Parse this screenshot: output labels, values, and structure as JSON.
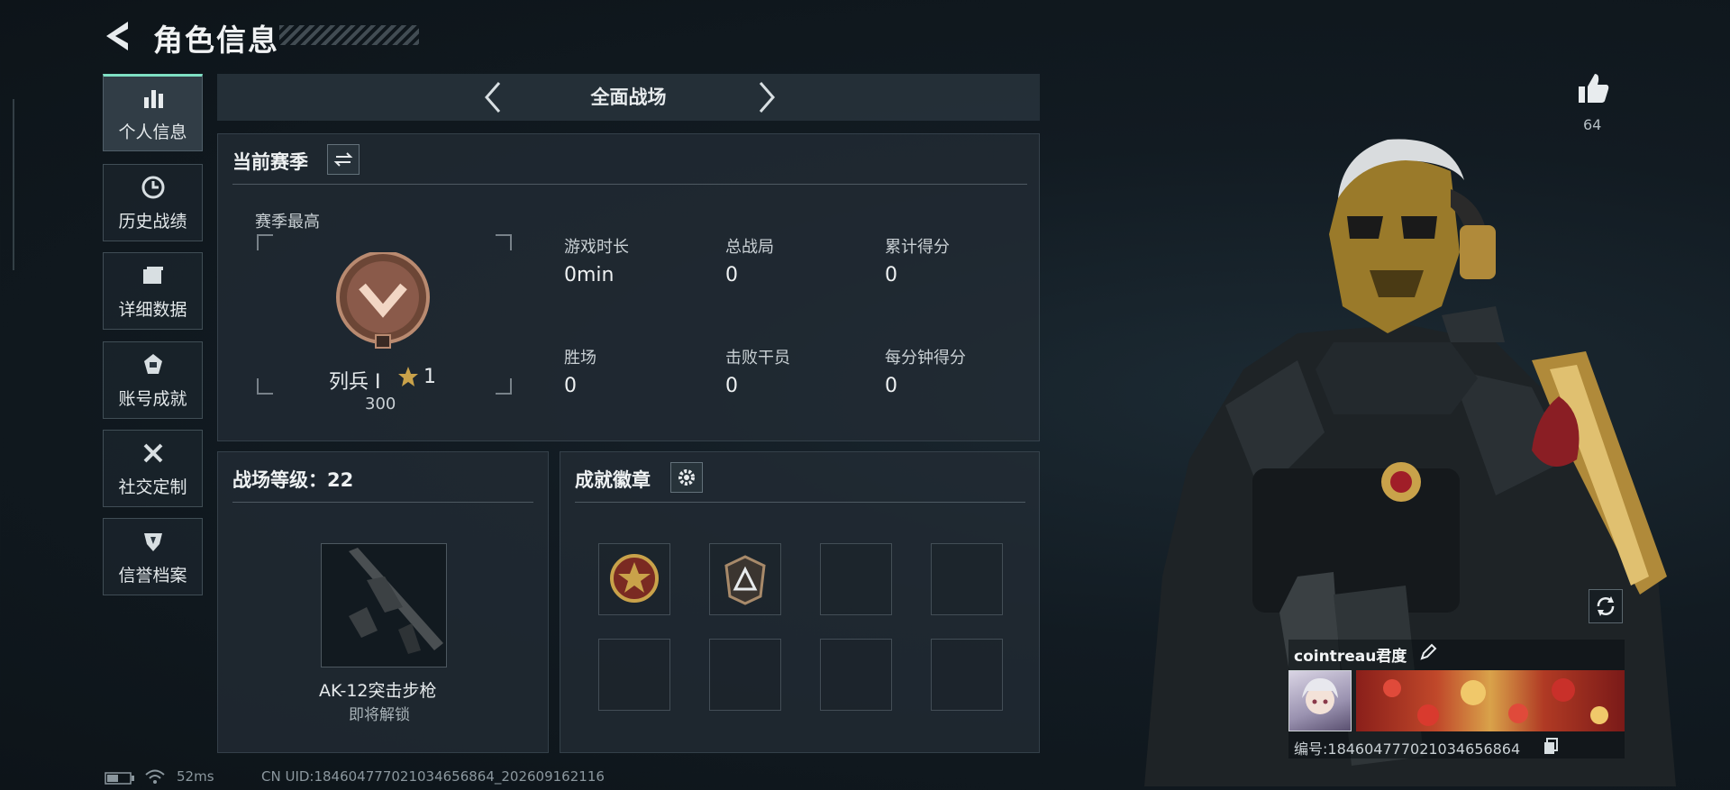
{
  "header": {
    "title": "角色信息"
  },
  "sidebar": {
    "items": [
      {
        "label": "个人信息",
        "icon": "bar-chart-icon"
      },
      {
        "label": "历史战绩",
        "icon": "clock-icon"
      },
      {
        "label": "详细数据",
        "icon": "folder-icon"
      },
      {
        "label": "账号成就",
        "icon": "medal-icon"
      },
      {
        "label": "社交定制",
        "icon": "tools-icon"
      },
      {
        "label": "信誉档案",
        "icon": "shield-icon"
      }
    ]
  },
  "mode": {
    "label": "全面战场"
  },
  "season": {
    "title": "当前赛季",
    "best_label": "赛季最高",
    "rank_name": "列兵 I",
    "rank_stars": "1",
    "rank_points": "300",
    "stats": [
      {
        "label": "游戏时长",
        "value": "0min"
      },
      {
        "label": "总战局",
        "value": "0"
      },
      {
        "label": "累计得分",
        "value": "0"
      },
      {
        "label": "胜场",
        "value": "0"
      },
      {
        "label": "击败干员",
        "value": "0"
      },
      {
        "label": "每分钟得分",
        "value": "0"
      }
    ]
  },
  "battlefield_level": {
    "title": "战场等级：22",
    "weapon_name": "AK-12突击步枪",
    "weapon_status": "即将解锁"
  },
  "badges": {
    "title": "成就徽章"
  },
  "profile": {
    "likes": "64",
    "player_name": "cointreau君度",
    "player_id": "编号:1846047770210346568​64"
  },
  "status_bar": {
    "ping": "52ms",
    "uid": "CN UID:184604777021034656864_202609162116"
  },
  "colors": {
    "accent": "#7fe0c4",
    "gold": "#c9a24a",
    "bronze": "#8a5a4a"
  }
}
